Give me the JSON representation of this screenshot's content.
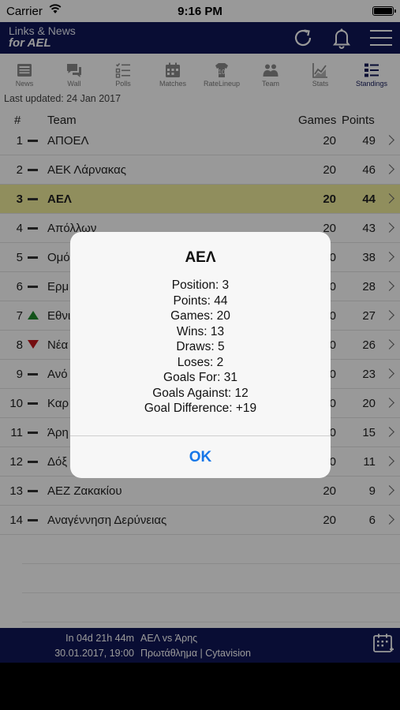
{
  "status_bar": {
    "carrier": "Carrier",
    "time": "9:16 PM"
  },
  "header": {
    "line1": "Links & News",
    "line2": "for AEL"
  },
  "tabs": [
    {
      "label": "News",
      "icon": "news-icon"
    },
    {
      "label": "Wall",
      "icon": "wall-icon"
    },
    {
      "label": "Polls",
      "icon": "polls-icon"
    },
    {
      "label": "Matches",
      "icon": "matches-icon"
    },
    {
      "label": "RateLineup",
      "icon": "rate-lineup-icon"
    },
    {
      "label": "Team",
      "icon": "team-icon"
    },
    {
      "label": "Stats",
      "icon": "stats-icon"
    },
    {
      "label": "Standings",
      "icon": "standings-icon"
    }
  ],
  "active_tab": "Standings",
  "last_updated": "Last updated: 24 Jan 2017",
  "table": {
    "headers": {
      "num": "#",
      "team": "Team",
      "games": "Games",
      "points": "Points"
    },
    "rows": [
      {
        "pos": "1",
        "trend": "same",
        "team": "ΑΠΟΕΛ",
        "games": "20",
        "points": "49"
      },
      {
        "pos": "2",
        "trend": "same",
        "team": "ΑΕΚ Λάρνακας",
        "games": "20",
        "points": "46"
      },
      {
        "pos": "3",
        "trend": "same",
        "team": "ΑΕΛ",
        "games": "20",
        "points": "44",
        "highlight": true
      },
      {
        "pos": "4",
        "trend": "same",
        "team": "Απόλλων",
        "games": "20",
        "points": "43"
      },
      {
        "pos": "5",
        "trend": "same",
        "team": "Ομό",
        "games": "20",
        "points": "38"
      },
      {
        "pos": "6",
        "trend": "same",
        "team": "Ερμ",
        "games": "20",
        "points": "28"
      },
      {
        "pos": "7",
        "trend": "up",
        "team": "Εθνι",
        "games": "20",
        "points": "27"
      },
      {
        "pos": "8",
        "trend": "down",
        "team": "Νέα",
        "games": "20",
        "points": "26"
      },
      {
        "pos": "9",
        "trend": "same",
        "team": "Ανό",
        "games": "20",
        "points": "23"
      },
      {
        "pos": "10",
        "trend": "same",
        "team": "Καρ",
        "games": "20",
        "points": "20"
      },
      {
        "pos": "11",
        "trend": "same",
        "team": "Άρη",
        "games": "20",
        "points": "15"
      },
      {
        "pos": "12",
        "trend": "same",
        "team": "Δόξ",
        "games": "20",
        "points": "11"
      },
      {
        "pos": "13",
        "trend": "same",
        "team": "ΑΕΖ Ζακακίου",
        "games": "20",
        "points": "9"
      },
      {
        "pos": "14",
        "trend": "same",
        "team": "Αναγέννηση Δερύνειας",
        "games": "20",
        "points": "6"
      }
    ]
  },
  "next_match": {
    "countdown": "In 04d 21h 44m",
    "datetime": "30.01.2017, 19:00",
    "teams": "ΑΕΛ vs Άρης",
    "competition": "Πρωτάθλημα | Cytavision"
  },
  "alert": {
    "title": "ΑΕΛ",
    "lines": [
      "Position: 3",
      "Points: 44",
      "Games: 20",
      "Wins: 13",
      "Draws: 5",
      "Loses: 2",
      "Goals For: 31",
      "Goals Against: 12",
      "Goal Difference: +19"
    ],
    "ok_label": "OK"
  },
  "colors": {
    "brand_navy": "#0f1658",
    "highlight_row": "#f1ed9c",
    "trend_up": "#1f8a2c",
    "trend_down": "#c3161c",
    "alert_button": "#1677e8"
  }
}
